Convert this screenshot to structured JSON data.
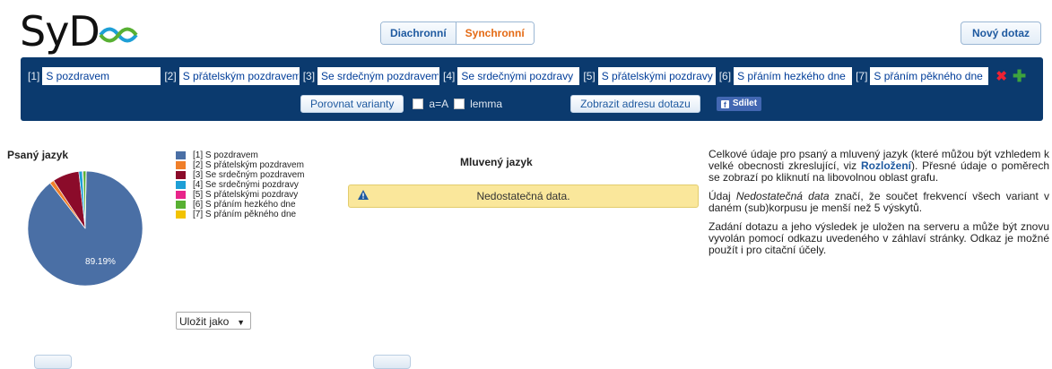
{
  "logo": {
    "text": "SyD"
  },
  "mode_tabs": [
    {
      "label": "Diachronní",
      "active": false
    },
    {
      "label": "Synchronní",
      "active": true
    }
  ],
  "new_query_label": "Nový dotaz",
  "query": {
    "variants": [
      {
        "num": "[1]",
        "value": "S pozdravem"
      },
      {
        "num": "[2]",
        "value": "S přátelským pozdravem"
      },
      {
        "num": "[3]",
        "value": "Se srdečným pozdravem"
      },
      {
        "num": "[4]",
        "value": "Se srdečnými pozdravy"
      },
      {
        "num": "[5]",
        "value": "S přátelskými pozdravy"
      },
      {
        "num": "[6]",
        "value": "S přáním hezkého dne"
      },
      {
        "num": "[7]",
        "value": "S přáním pěkného dne"
      }
    ],
    "remove_icon": "✖",
    "add_icon": "✚",
    "compare_label": "Porovnat varianty",
    "case_label": "a=A",
    "lemma_label": "lemma",
    "show_address_label": "Zobrazit adresu dotazu",
    "share_label": "Sdílet",
    "colors": {
      "panel": "#0b3a6e"
    }
  },
  "written": {
    "title": "Psaný jazyk",
    "pie_label": "89.19%",
    "legend": [
      {
        "label": "[1] S pozdravem",
        "color": "#4a6fa5"
      },
      {
        "label": "[2] S přátelským pozdravem",
        "color": "#f07f2a"
      },
      {
        "label": "[3] Se srdečným pozdravem",
        "color": "#8b0b2a"
      },
      {
        "label": "[4] Se srdečnými pozdravy",
        "color": "#1e9fd6"
      },
      {
        "label": "[5] S přátelskými pozdravy",
        "color": "#e8258a"
      },
      {
        "label": "[6] S přáním hezkého dne",
        "color": "#58b033"
      },
      {
        "label": "[7] S přáním pěkného dne",
        "color": "#f2c300"
      }
    ],
    "save_label": "Uložit jako"
  },
  "spoken": {
    "title": "Mluvený jazyk",
    "warning": "Nedostatečná data."
  },
  "info": {
    "p1_a": "Celkové údaje pro psaný a mluvený jazyk (které můžou být vzhledem k velké obecnosti zkreslující, viz ",
    "p1_link": "Rozložení",
    "p1_b": "). Přesné údaje o poměrech se zobrazí po kliknutí na libovolnou oblast grafu.",
    "p2_a": "Údaj ",
    "p2_em": "Nedostatečná data",
    "p2_b": " značí, že součet frekvencí všech variant v daném (sub)korpusu je menší než 5 výskytů.",
    "p3": "Zadání dotazu a jeho výsledek je uložen na serveru a může být znovu vyvolán pomocí odkazu uvedeného v záhlaví stránky. Odkaz je možné použít i pro citační účely."
  },
  "chart_data": {
    "type": "pie",
    "title": "Psaný jazyk",
    "labels": [
      "[1] S pozdravem",
      "[2] S přátelským pozdravem",
      "[3] Se srdečným pozdravem",
      "[4] Se srdečnými pozdravy",
      "[5] S přátelskými pozdravy",
      "[6] S přáním hezkého dne",
      "[7] S přáním pěkného dne"
    ],
    "values": [
      89.19,
      1.2,
      7.5,
      1.0,
      0.2,
      0.8,
      0.11
    ],
    "colors": [
      "#4a6fa5",
      "#f07f2a",
      "#8b0b2a",
      "#1e9fd6",
      "#e8258a",
      "#58b033",
      "#f2c300"
    ]
  }
}
